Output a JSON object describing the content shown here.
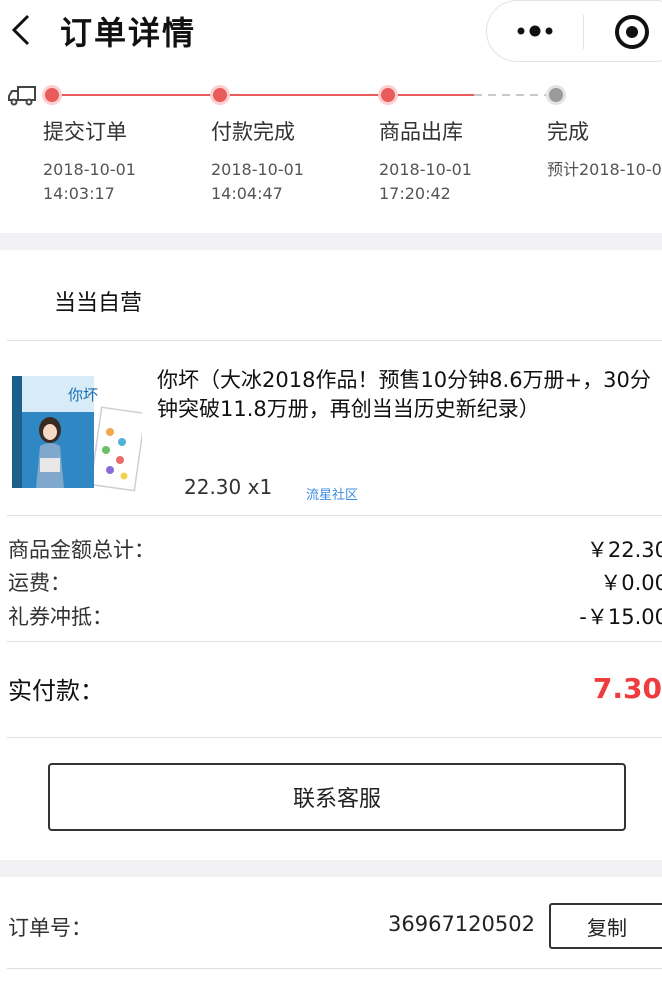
{
  "header": {
    "title": "订单详情",
    "back_icon": "chevron-left-icon",
    "more_icon": "more-dots-icon",
    "close_icon": "target-circle-icon"
  },
  "progress": {
    "icon": "truck-icon",
    "steps": [
      {
        "label": "提交订单",
        "date": "2018-10-01",
        "time": "14:03:17",
        "done": true
      },
      {
        "label": "付款完成",
        "date": "2018-10-01",
        "time": "14:04:47",
        "done": true
      },
      {
        "label": "商品出库",
        "date": "2018-10-01",
        "time": "17:20:42",
        "done": true
      },
      {
        "label": "完成",
        "date": "预计2018-10-0",
        "time": "",
        "done": false
      }
    ],
    "colors": {
      "done": "#ea5b5b",
      "todo": "#9a9a9a"
    }
  },
  "shop": {
    "name": "当当自营"
  },
  "product": {
    "title": "你坏（大冰2018作品！预售10分钟8.6万册+，30分钟突破11.8万册，再创当当历史新纪录）",
    "price_qty": "22.30 x1",
    "publisher": "流星社区",
    "cover_text": "你坏"
  },
  "summary": {
    "rows": [
      {
        "label": "商品金额总计：",
        "value": "￥22.30"
      },
      {
        "label": "运费：",
        "value": "￥0.00"
      },
      {
        "label": "礼券冲抵：",
        "value": "-￥15.00"
      }
    ],
    "paid_label": "实付款：",
    "paid_value": "7.30",
    "accent_color": "#f03c3c"
  },
  "actions": {
    "contact_label": "联系客服"
  },
  "order": {
    "label": "订单号：",
    "number": "36967120502",
    "copy_label": "复制"
  }
}
